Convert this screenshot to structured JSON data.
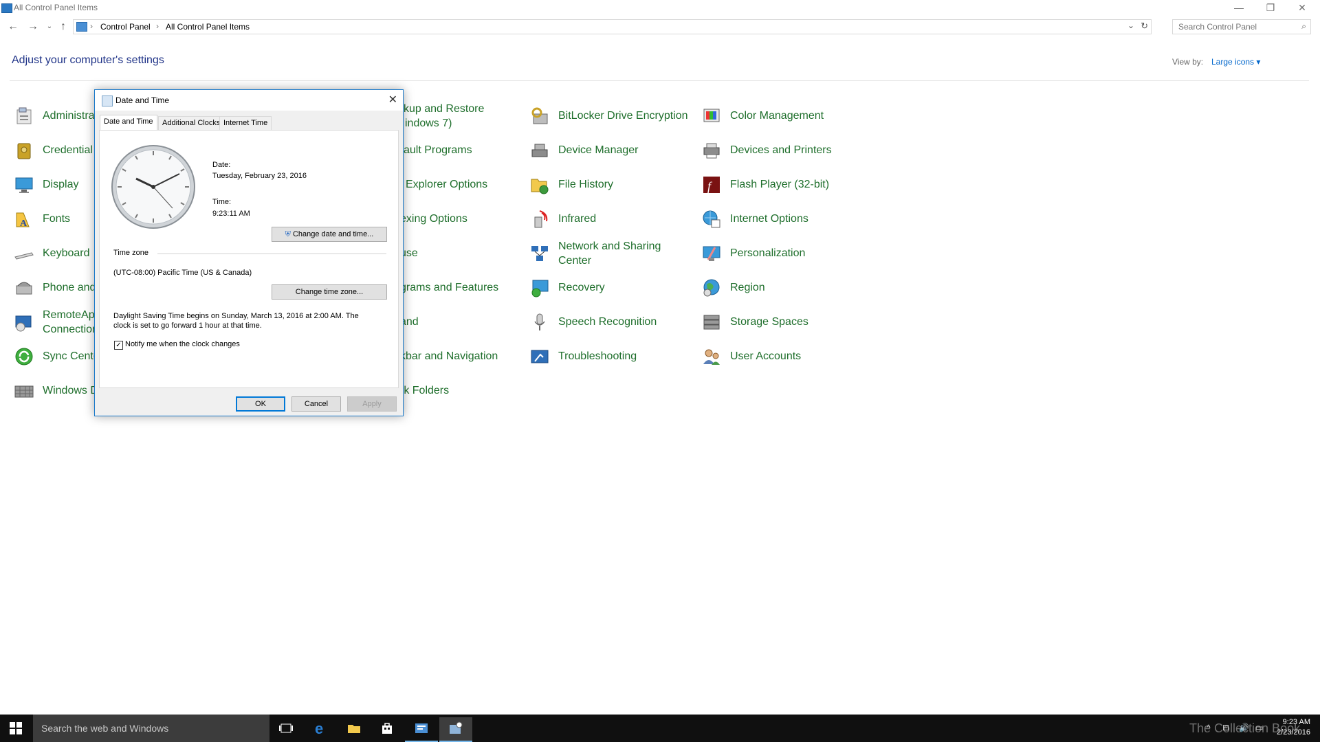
{
  "window": {
    "title": "All Control Panel Items",
    "controls": {
      "minimize": "—",
      "restore": "❐",
      "close": "✕"
    }
  },
  "address": {
    "breadcrumbs": [
      "Control Panel",
      "All Control Panel Items"
    ],
    "search_placeholder": "Search Control Panel"
  },
  "main": {
    "heading": "Adjust your computer's settings",
    "view_by_label": "View by:",
    "view_by_value": "Large icons ▾"
  },
  "items": {
    "col1": [
      "Administra",
      "Credential",
      "Display",
      "Fonts",
      "Keyboard",
      "Phone and",
      "RemoteApp",
      "Sync Cente",
      "Windows D"
    ],
    "col1_remote_line2": "Connection",
    "col2": [
      "kup and Restore",
      "ault Programs",
      "Explorer Options",
      "exing Options",
      "use",
      "grams and Features",
      "and",
      "kbar and Navigation",
      "rk Folders"
    ],
    "col2_backup_line2": "indows 7)",
    "col3": [
      "BitLocker Drive Encryption",
      "Device Manager",
      "File History",
      "Infrared",
      "Network and Sharing",
      "Recovery",
      "Speech Recognition",
      "Troubleshooting"
    ],
    "col3_network_line2": "Center",
    "col4": [
      "Color Management",
      "Devices and Printers",
      "Flash Player (32-bit)",
      "Internet Options",
      "Personalization",
      "Region",
      "Storage Spaces",
      "User Accounts"
    ]
  },
  "dialog": {
    "title": "Date and Time",
    "tabs": [
      "Date and Time",
      "Additional Clocks",
      "Internet Time"
    ],
    "date_label": "Date:",
    "date_value": "Tuesday, February 23, 2016",
    "time_label": "Time:",
    "time_value": "9:23:11 AM",
    "change_datetime_button": "Change date and time...",
    "timezone_label": "Time zone",
    "timezone_value": "(UTC-08:00) Pacific Time (US & Canada)",
    "change_timezone_button": "Change time zone...",
    "dst_line1": "Daylight Saving Time begins on Sunday, March 13, 2016 at 2:00 AM. The",
    "dst_line2": "clock is set to go forward 1 hour at that time.",
    "notify_checked_mark": "✓",
    "notify_label": "Notify me when the clock changes",
    "ok": "OK",
    "cancel": "Cancel",
    "apply": "Apply"
  },
  "taskbar": {
    "search_placeholder": "Search the web and Windows",
    "time": "9:23 AM",
    "date": "2/23/2016",
    "watermark": "The Collection Book"
  }
}
